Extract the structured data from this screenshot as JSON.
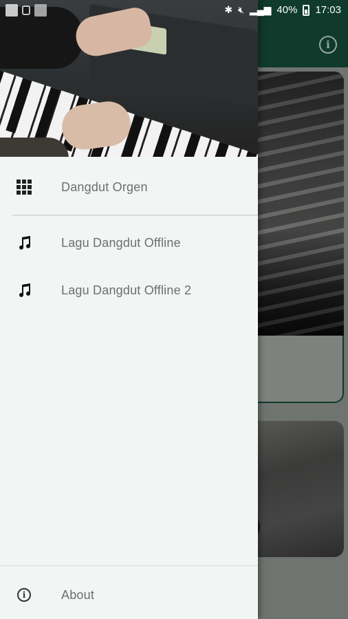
{
  "status_bar": {
    "battery": "40%",
    "time": "17:03"
  },
  "app": {
    "info_icon": "i"
  },
  "drawer": {
    "items": [
      {
        "label": "Dangdut Orgen",
        "icon": "grid-icon"
      },
      {
        "label": "Lagu Dangdut Offline",
        "icon": "music-note-icon"
      },
      {
        "label": "Lagu Dangdut Offline 2",
        "icon": "music-note-icon"
      }
    ],
    "footer": {
      "label": "About",
      "icon": "info-icon"
    }
  },
  "colors": {
    "toolbar": "#0f3a2c",
    "drawer_bg": "#f1f6f4",
    "label": "#6b6f6d"
  }
}
